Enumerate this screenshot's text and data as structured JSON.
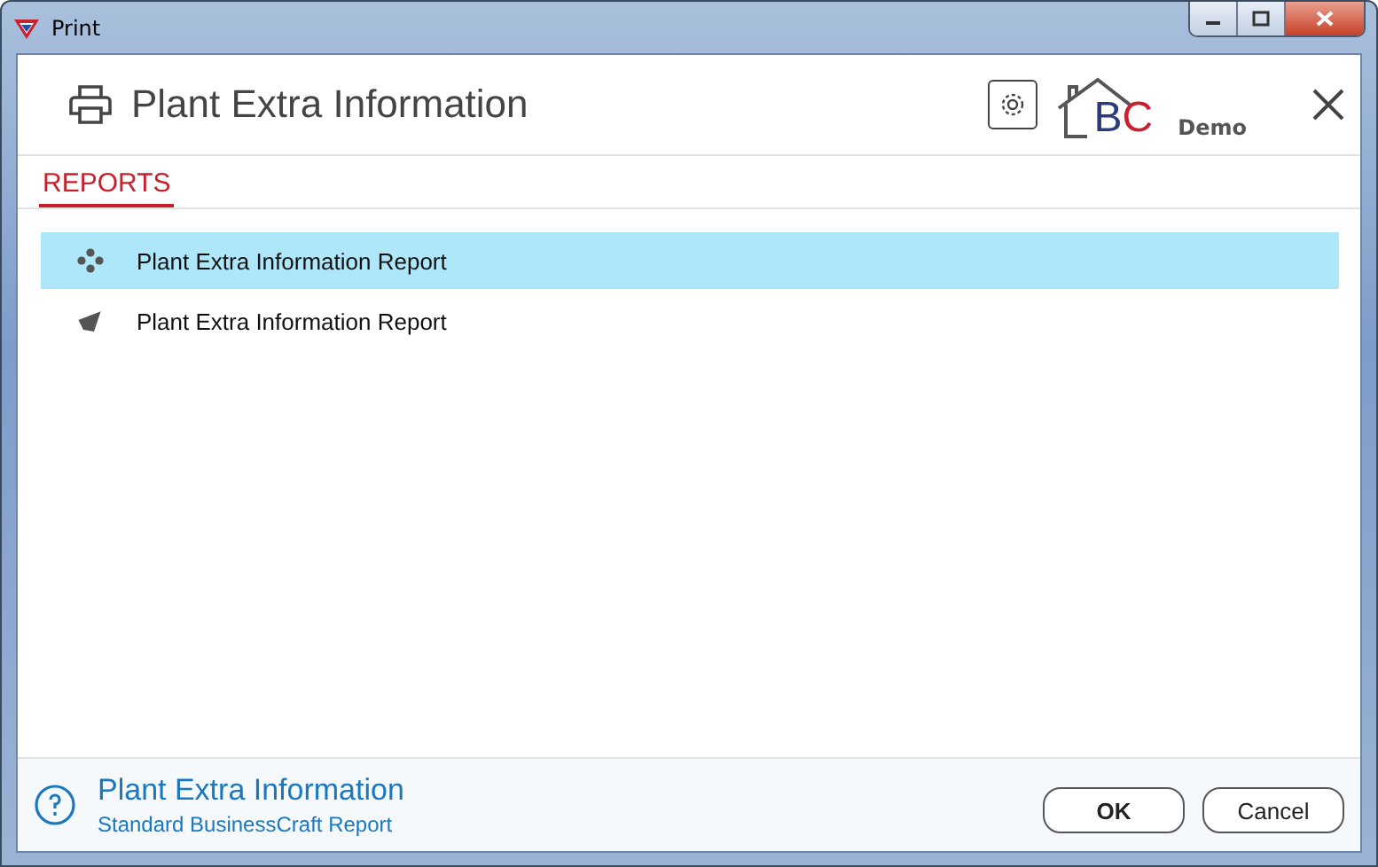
{
  "window": {
    "title": "Print"
  },
  "header": {
    "title": "Plant Extra Information",
    "logo": {
      "letter_1": "B",
      "letter_2": "C",
      "edition": "Demo"
    }
  },
  "tabs": [
    {
      "label": "REPORTS",
      "selected": true
    }
  ],
  "reports": [
    {
      "label": "Plant Extra Information Report",
      "kind": "dots",
      "selected": true
    },
    {
      "label": "Plant Extra Information Report",
      "kind": "wing",
      "selected": false
    }
  ],
  "footer": {
    "title": "Plant Extra Information",
    "subtitle": "Standard BusinessCraft Report"
  },
  "buttons": [
    {
      "label": "OK",
      "kind": "ok"
    },
    {
      "label": "Cancel",
      "kind": "cancel"
    }
  ]
}
